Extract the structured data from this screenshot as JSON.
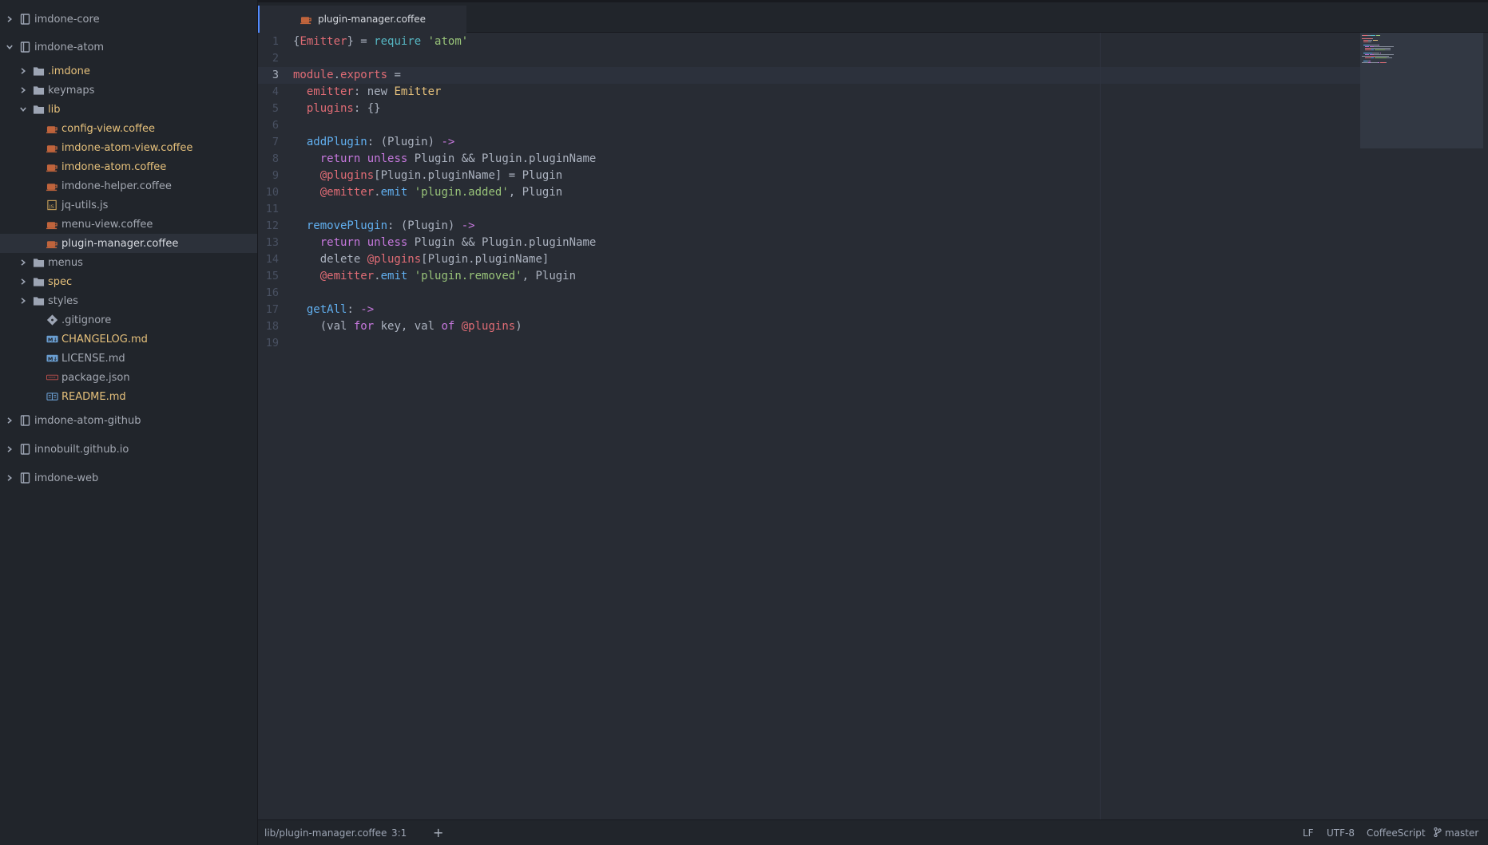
{
  "tree": {
    "rows": [
      {
        "label": "imdone-core",
        "kind": "repo",
        "chevron": "right",
        "mod": false
      },
      {
        "label": "imdone-atom",
        "kind": "repo",
        "chevron": "down",
        "mod": false
      },
      {
        "label": ".imdone",
        "kind": "folder",
        "chevron": "right",
        "mod": true
      },
      {
        "label": "keymaps",
        "kind": "folder",
        "chevron": "right",
        "mod": false
      },
      {
        "label": "lib",
        "kind": "folder-open",
        "chevron": "down",
        "mod": true
      },
      {
        "label": "config-view.coffee",
        "kind": "coffee",
        "chevron": "none",
        "mod": true
      },
      {
        "label": "imdone-atom-view.coffee",
        "kind": "coffee",
        "chevron": "none",
        "mod": true
      },
      {
        "label": "imdone-atom.coffee",
        "kind": "coffee",
        "chevron": "none",
        "mod": true
      },
      {
        "label": "imdone-helper.coffee",
        "kind": "coffee",
        "chevron": "none",
        "mod": false
      },
      {
        "label": "jq-utils.js",
        "kind": "js",
        "chevron": "none",
        "mod": false
      },
      {
        "label": "menu-view.coffee",
        "kind": "coffee",
        "chevron": "none",
        "mod": false
      },
      {
        "label": "plugin-manager.coffee",
        "kind": "coffee",
        "chevron": "none",
        "mod": false,
        "selected": true
      },
      {
        "label": "menus",
        "kind": "folder",
        "chevron": "right",
        "mod": false
      },
      {
        "label": "spec",
        "kind": "folder",
        "chevron": "right",
        "mod": true
      },
      {
        "label": "styles",
        "kind": "folder",
        "chevron": "right",
        "mod": false
      },
      {
        "label": ".gitignore",
        "kind": "git",
        "chevron": "none",
        "mod": false
      },
      {
        "label": "CHANGELOG.md",
        "kind": "md",
        "chevron": "none",
        "mod": true
      },
      {
        "label": "LICENSE.md",
        "kind": "md",
        "chevron": "none",
        "mod": false
      },
      {
        "label": "package.json",
        "kind": "json",
        "chevron": "none",
        "mod": false
      },
      {
        "label": "README.md",
        "kind": "readme",
        "chevron": "none",
        "mod": true
      },
      {
        "label": "imdone-atom-github",
        "kind": "repo",
        "chevron": "right",
        "mod": false
      },
      {
        "label": "innobuilt.github.io",
        "kind": "repo",
        "chevron": "right",
        "mod": false
      },
      {
        "label": "imdone-web",
        "kind": "repo",
        "chevron": "right",
        "mod": false
      }
    ]
  },
  "tab": {
    "label": "plugin-manager.coffee",
    "icon": "coffee-icon"
  },
  "editor": {
    "cursor_line": 3,
    "lines": [
      [
        [
          "{",
          "op"
        ],
        [
          "Emitter",
          "var"
        ],
        [
          "} = ",
          "op"
        ],
        [
          "require",
          "sup"
        ],
        [
          " ",
          "op"
        ],
        [
          "'atom'",
          "str"
        ]
      ],
      [],
      [
        [
          "module",
          "var"
        ],
        [
          ".",
          "op"
        ],
        [
          "exports",
          "var"
        ],
        [
          " =",
          "op"
        ]
      ],
      [
        [
          "  ",
          "op"
        ],
        [
          "emitter",
          "var"
        ],
        [
          ": ",
          "op"
        ],
        [
          "new",
          "op"
        ],
        [
          " ",
          "op"
        ],
        [
          "Emitter",
          "cls"
        ]
      ],
      [
        [
          "  ",
          "op"
        ],
        [
          "plugins",
          "var"
        ],
        [
          ": {}",
          "op"
        ]
      ],
      [],
      [
        [
          "  ",
          "op"
        ],
        [
          "addPlugin",
          "fn"
        ],
        [
          ": (Plugin) ",
          "op"
        ],
        [
          "->",
          "kw"
        ]
      ],
      [
        [
          "    ",
          "op"
        ],
        [
          "return",
          "kw"
        ],
        [
          " ",
          "op"
        ],
        [
          "unless",
          "kw"
        ],
        [
          " Plugin && Plugin.pluginName",
          "op"
        ]
      ],
      [
        [
          "    ",
          "op"
        ],
        [
          "@plugins",
          "var"
        ],
        [
          "[Plugin.pluginName] = Plugin",
          "op"
        ]
      ],
      [
        [
          "    ",
          "op"
        ],
        [
          "@emitter",
          "var"
        ],
        [
          ".",
          "op"
        ],
        [
          "emit",
          "fn"
        ],
        [
          " ",
          "op"
        ],
        [
          "'plugin.added'",
          "str"
        ],
        [
          ", Plugin",
          "op"
        ]
      ],
      [],
      [
        [
          "  ",
          "op"
        ],
        [
          "removePlugin",
          "fn"
        ],
        [
          ": (Plugin) ",
          "op"
        ],
        [
          "->",
          "kw"
        ]
      ],
      [
        [
          "    ",
          "op"
        ],
        [
          "return",
          "kw"
        ],
        [
          " ",
          "op"
        ],
        [
          "unless",
          "kw"
        ],
        [
          " Plugin && Plugin.pluginName",
          "op"
        ]
      ],
      [
        [
          "    delete ",
          "op"
        ],
        [
          "@plugins",
          "var"
        ],
        [
          "[Plugin.pluginName]",
          "op"
        ]
      ],
      [
        [
          "    ",
          "op"
        ],
        [
          "@emitter",
          "var"
        ],
        [
          ".",
          "op"
        ],
        [
          "emit",
          "fn"
        ],
        [
          " ",
          "op"
        ],
        [
          "'plugin.removed'",
          "str"
        ],
        [
          ", Plugin",
          "op"
        ]
      ],
      [],
      [
        [
          "  ",
          "op"
        ],
        [
          "getAll",
          "fn"
        ],
        [
          ": ",
          "op"
        ],
        [
          "->",
          "kw"
        ]
      ],
      [
        [
          "    (val ",
          "op"
        ],
        [
          "for",
          "kw"
        ],
        [
          " key, val ",
          "op"
        ],
        [
          "of",
          "kw"
        ],
        [
          " ",
          "op"
        ],
        [
          "@plugins",
          "var"
        ],
        [
          ")",
          "op"
        ]
      ],
      []
    ]
  },
  "status": {
    "file_path": "lib/plugin-manager.coffee",
    "cursor_position": "3:1",
    "add_symbol": "+",
    "line_ending": "LF",
    "encoding": "UTF-8",
    "grammar": "CoffeeScript",
    "branch": "master"
  },
  "colors": {
    "accent": "#528bff",
    "modified": "#e5c07b",
    "coffee_icon": "#c0643c",
    "folder_icon": "#9da5b4"
  }
}
